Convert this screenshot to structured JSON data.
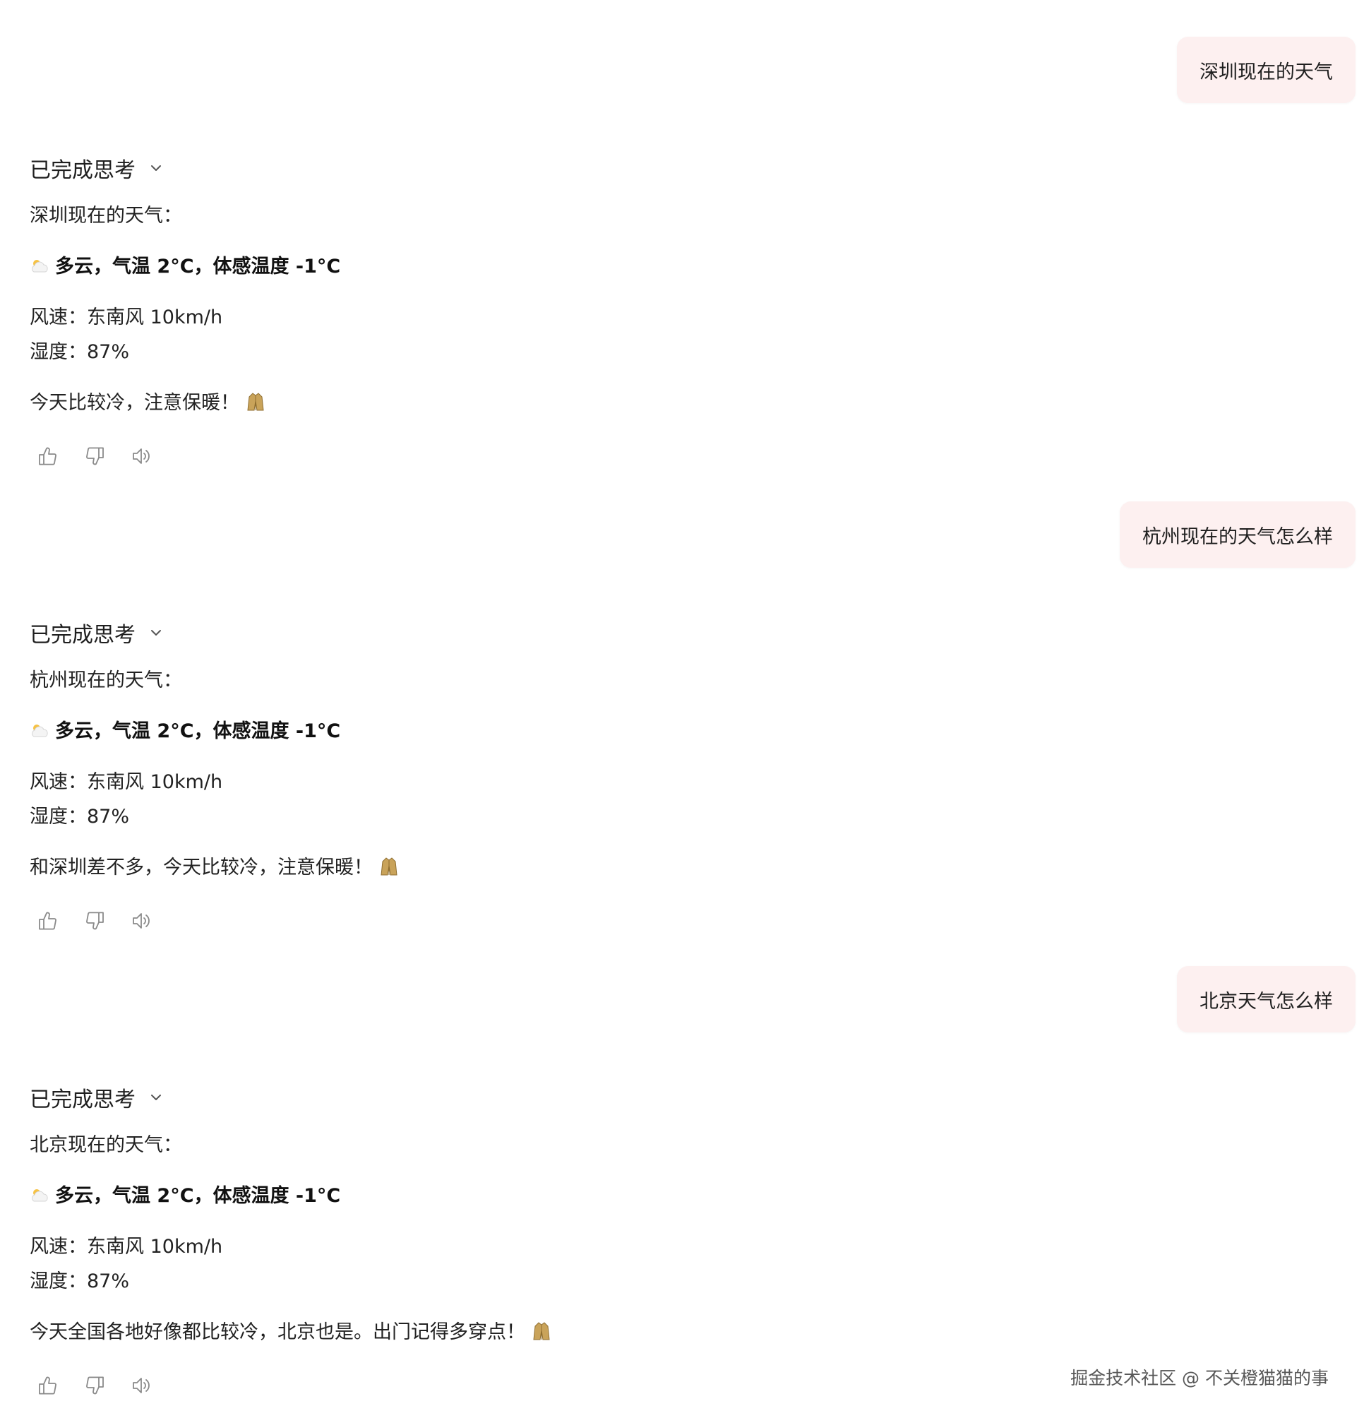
{
  "conversation": [
    {
      "user": "深圳现在的天气",
      "assistant": {
        "thinking_label": "已完成思考",
        "heading": "深圳现在的天气：",
        "condition_prefix": "多云",
        "condition_temp_label": "，气温 ",
        "temp": "2°C",
        "feels_label": "，体感温度 ",
        "feels": "-1°C",
        "wind": "风速：东南风 10km/h",
        "humidity": "湿度：87%",
        "tip": "今天比较冷，注意保暖！"
      }
    },
    {
      "user": "杭州现在的天气怎么样",
      "assistant": {
        "thinking_label": "已完成思考",
        "heading": "杭州现在的天气：",
        "condition_prefix": "多云",
        "condition_temp_label": "，气温 ",
        "temp": "2°C",
        "feels_label": "，体感温度 ",
        "feels": "-1°C",
        "wind": "风速：东南风 10km/h",
        "humidity": "湿度：87%",
        "tip": "和深圳差不多，今天比较冷，注意保暖！"
      }
    },
    {
      "user": "北京天气怎么样",
      "assistant": {
        "thinking_label": "已完成思考",
        "heading": "北京现在的天气：",
        "condition_prefix": "多云",
        "condition_temp_label": "，气温 ",
        "temp": "2°C",
        "feels_label": "，体感温度 ",
        "feels": "-1°C",
        "wind": "风速：东南风 10km/h",
        "humidity": "湿度：87%",
        "tip": "今天全国各地好像都比较冷，北京也是。出门记得多穿点！"
      }
    }
  ],
  "icons": {
    "weather": "partly-cloudy-icon",
    "tip": "coat-icon",
    "like": "thumbs-up-icon",
    "dislike": "thumbs-down-icon",
    "speak": "speaker-icon",
    "expand": "chevron-down-icon"
  },
  "watermark": "掘金技术社区 @ 不关橙猫猫的事",
  "colors": {
    "user_bubble": "#fdf0f0",
    "text": "#1f1f1f",
    "icon": "#8a8a8a"
  }
}
